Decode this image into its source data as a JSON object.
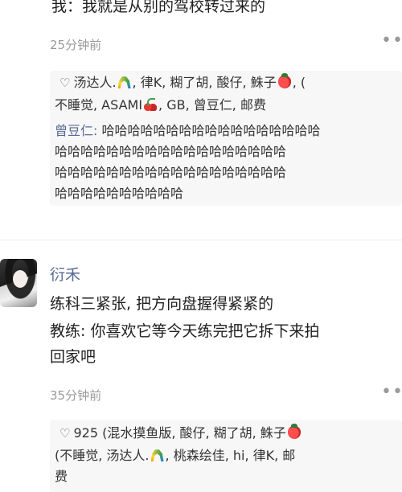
{
  "post1": {
    "content_lines": [
      "我：我就是从别的驾校转过来的"
    ],
    "timestamp": "25分钟前",
    "more": "••",
    "likes": {
      "line1": [
        {
          "text": "汤达人."
        },
        {
          "emoji": "rainbow"
        },
        {
          "text": ", 律K, 糊了胡, 酸仔, 鮢子"
        },
        {
          "emoji": "strawberry"
        },
        {
          "text": ", ("
        }
      ],
      "line2": [
        {
          "text": "不睡觉, ASAMI"
        },
        {
          "emoji": "cherry"
        },
        {
          "text": ", GB, 曾豆仁, 邮费"
        }
      ]
    },
    "reply": {
      "name": "曾豆仁: ",
      "lines": [
        "哈哈哈哈哈哈哈哈哈哈哈哈哈哈哈哈哈",
        "哈哈哈哈哈哈哈哈哈哈哈哈哈哈哈哈哈哈",
        "哈哈哈哈哈哈哈哈哈哈哈哈哈哈哈哈哈哈",
        "哈哈哈哈哈哈哈哈哈哈"
      ]
    }
  },
  "post2": {
    "username": "衍禾",
    "content_lines": [
      "练科三紧张, 把方向盘握得紧紧的",
      "教练: 你喜欢它等今天练完把它拆下来拍",
      "回家吧"
    ],
    "timestamp": "35分钟前",
    "more": "••",
    "likes": {
      "line1": [
        {
          "text": "925 (混水摸鱼版, 酸仔, 糊了胡, 鮢子"
        },
        {
          "emoji": "strawberry"
        }
      ],
      "line2": [
        {
          "text": "(不睡觉, 汤达人."
        },
        {
          "emoji": "rainbow"
        },
        {
          "text": ", 桃森绘佳, hi, 律K, 邮"
        }
      ],
      "line3": [
        {
          "text": "费"
        }
      ]
    }
  },
  "icons": {
    "like": "heart-outline-icon",
    "more": "more-dots-icon"
  },
  "colors": {
    "name_link": "#576b95",
    "timestamp": "#9a9a9a",
    "like_box_bg": "#f7f7f7"
  }
}
